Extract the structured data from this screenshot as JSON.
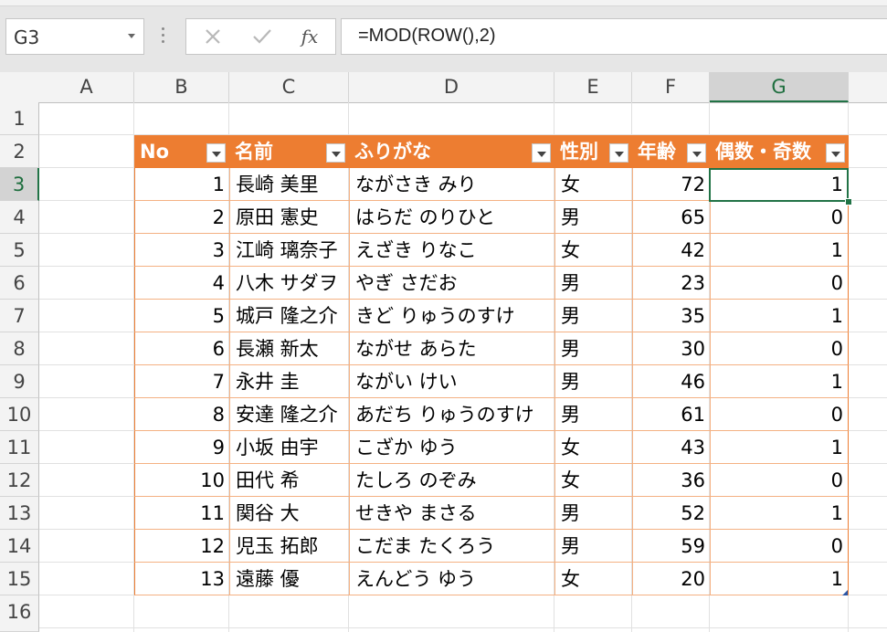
{
  "formula_bar": {
    "name_box": "G3",
    "formula": "=MOD(ROW(),2)",
    "fx_label": "fx"
  },
  "columns": [
    {
      "label": "A",
      "selected": false
    },
    {
      "label": "B",
      "selected": false
    },
    {
      "label": "C",
      "selected": false
    },
    {
      "label": "D",
      "selected": false
    },
    {
      "label": "E",
      "selected": false
    },
    {
      "label": "F",
      "selected": false
    },
    {
      "label": "G",
      "selected": true
    }
  ],
  "rows": [
    "1",
    "2",
    "3",
    "4",
    "5",
    "6",
    "7",
    "8",
    "9",
    "10",
    "11",
    "12",
    "13",
    "14",
    "15",
    "16"
  ],
  "selected_row": "3",
  "colors": {
    "table_header": "#ed7d31",
    "table_border": "#f4b183",
    "selection": "#217346"
  },
  "table": {
    "headers": [
      "No",
      "名前",
      "ふりがな",
      "性別",
      "年齢",
      "偶数・奇数"
    ],
    "rows": [
      [
        "1",
        "長崎 美里",
        "ながさき みり",
        "女",
        "72",
        "1"
      ],
      [
        "2",
        "原田 憲史",
        "はらだ のりひと",
        "男",
        "65",
        "0"
      ],
      [
        "3",
        "江崎 璃奈子",
        "えざき りなこ",
        "女",
        "42",
        "1"
      ],
      [
        "4",
        "八木 サダヲ",
        "やぎ さだお",
        "男",
        "23",
        "0"
      ],
      [
        "5",
        "城戸 隆之介",
        "きど りゅうのすけ",
        "男",
        "35",
        "1"
      ],
      [
        "6",
        "長瀬 新太",
        "ながせ あらた",
        "男",
        "30",
        "0"
      ],
      [
        "7",
        "永井 圭",
        "ながい けい",
        "男",
        "46",
        "1"
      ],
      [
        "8",
        "安達 隆之介",
        "あだち りゅうのすけ",
        "男",
        "61",
        "0"
      ],
      [
        "9",
        "小坂 由宇",
        "こざか ゆう",
        "女",
        "43",
        "1"
      ],
      [
        "10",
        "田代 希",
        "たしろ のぞみ",
        "女",
        "36",
        "0"
      ],
      [
        "11",
        "関谷 大",
        "せきや まさる",
        "男",
        "52",
        "1"
      ],
      [
        "12",
        "児玉 拓郎",
        "こだま たくろう",
        "男",
        "59",
        "0"
      ],
      [
        "13",
        "遠藤 優",
        "えんどう ゆう",
        "女",
        "20",
        "1"
      ]
    ]
  }
}
